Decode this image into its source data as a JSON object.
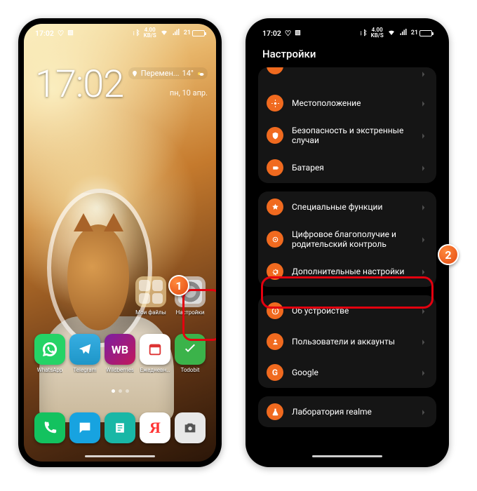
{
  "status": {
    "time": "17:02",
    "net_speed": "4.00",
    "net_unit": "KB/S",
    "battery_pct": "21"
  },
  "callouts": {
    "one": "1",
    "two": "2"
  },
  "home": {
    "clock": "17:02",
    "weather_text": "Перемен...",
    "weather_temp": "14°",
    "date": "пн, 10 апр.",
    "folders": {
      "files": "Мои файлы",
      "settings": "Настройки"
    },
    "apps": {
      "whatsapp": "WhatsApp",
      "telegram": "Telegram",
      "wildberries": "Wildberries",
      "daily": "Ежедневн…",
      "todobit": "Todobit"
    }
  },
  "settings": {
    "title": "Настройки",
    "items": {
      "location": "Местоположение",
      "security": "Безопасность и экстренные случаи",
      "battery": "Батарея",
      "special": "Специальные функции",
      "wellbeing": "Цифровое благополучие и родительский контроль",
      "additional": "Дополнительные настройки",
      "about": "Об устройстве",
      "users": "Пользователи и аккаунты",
      "google": "Google",
      "lab": "Лаборатория realme"
    }
  }
}
